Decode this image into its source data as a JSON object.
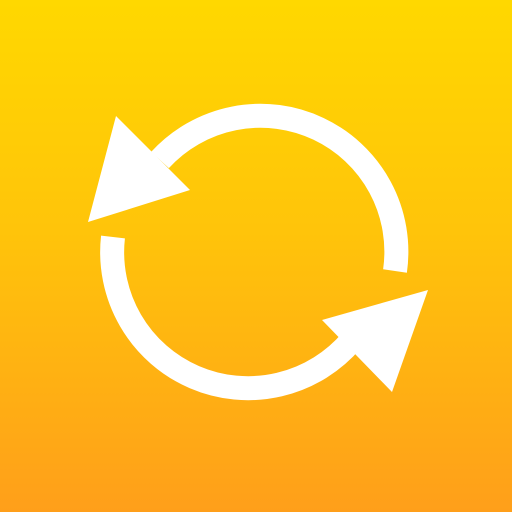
{
  "icon": {
    "name": "refresh-icon",
    "glyph_color": "#ffffff",
    "gradient_top": "#ffd800",
    "gradient_mid": "#ffc40a",
    "gradient_bottom": "#ff9f1a"
  }
}
